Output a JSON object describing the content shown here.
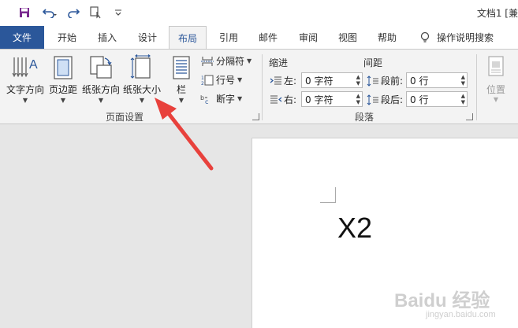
{
  "window": {
    "doc_title": "文档1 [兼"
  },
  "tabs": {
    "file": "文件",
    "items": [
      "开始",
      "插入",
      "设计",
      "布局",
      "引用",
      "邮件",
      "审阅",
      "视图",
      "帮助"
    ],
    "active": "布局",
    "tell_me": "操作说明搜索"
  },
  "ribbon": {
    "page_setup": {
      "text_direction": "文字方向",
      "margins": "页边距",
      "orientation": "纸张方向",
      "size": "纸张大小",
      "columns": "栏",
      "breaks": "分隔符",
      "line_numbers": "行号",
      "hyphenation": "断字",
      "group_label": "页面设置"
    },
    "paragraph": {
      "indent_title": "缩进",
      "spacing_title": "间距",
      "left_label": "左:",
      "right_label": "右:",
      "before_label": "段前:",
      "after_label": "段后:",
      "left_value": "0 字符",
      "right_value": "0 字符",
      "before_value": "0 行",
      "after_value": "0 行",
      "group_label": "段落"
    },
    "arrange": {
      "position": "位置"
    }
  },
  "document": {
    "body_text": "X2"
  },
  "watermark": {
    "brand": "Baidu 经验",
    "url": "jingyan.baidu.com"
  },
  "colors": {
    "accent": "#2b579a",
    "annotation": "#e8413c"
  }
}
